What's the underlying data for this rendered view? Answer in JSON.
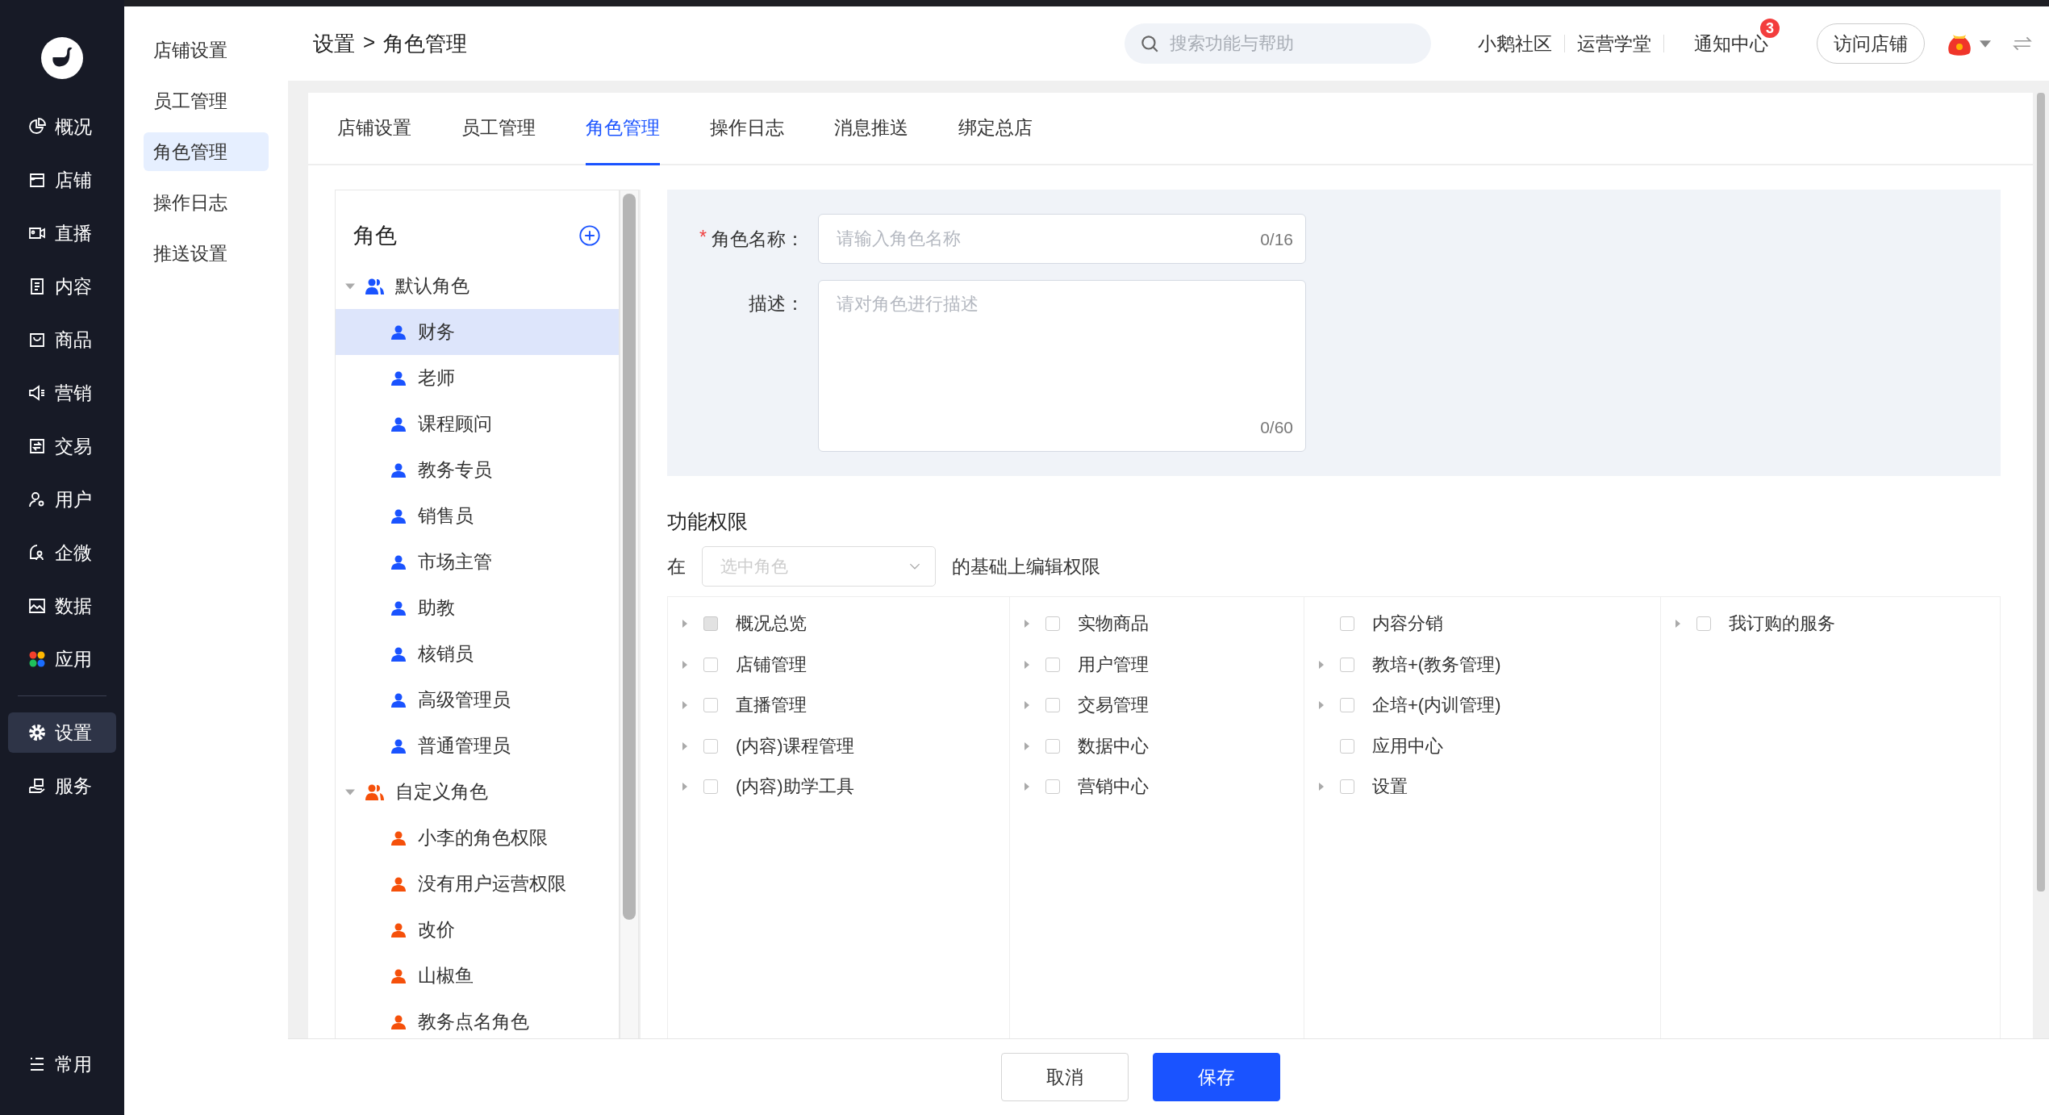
{
  "sidebar": {
    "items": [
      {
        "label": "概况",
        "selected": false
      },
      {
        "label": "店铺",
        "selected": false
      },
      {
        "label": "直播",
        "selected": false
      },
      {
        "label": "内容",
        "selected": false
      },
      {
        "label": "商品",
        "selected": false
      },
      {
        "label": "营销",
        "selected": false
      },
      {
        "label": "交易",
        "selected": false
      },
      {
        "label": "用户",
        "selected": false
      },
      {
        "label": "企微",
        "selected": false
      },
      {
        "label": "数据",
        "selected": false
      },
      {
        "label": "应用",
        "selected": false
      },
      {
        "label": "设置",
        "selected": true
      },
      {
        "label": "服务",
        "selected": false
      }
    ],
    "bottom_item": {
      "label": "常用"
    }
  },
  "subnav": {
    "items": [
      {
        "label": "店铺设置",
        "selected": false
      },
      {
        "label": "员工管理",
        "selected": false
      },
      {
        "label": "角色管理",
        "selected": true
      },
      {
        "label": "操作日志",
        "selected": false
      },
      {
        "label": "推送设置",
        "selected": false
      }
    ]
  },
  "header": {
    "breadcrumb": [
      "设置",
      "角色管理"
    ],
    "separator": ">",
    "search": {
      "placeholder": "搜索功能与帮助"
    },
    "links": [
      {
        "label": "小鹅社区"
      },
      {
        "label": "运营学堂"
      },
      {
        "label": "通知中心",
        "badge": "3"
      }
    ],
    "visit_button": "访问店铺"
  },
  "tabs": [
    {
      "label": "店铺设置",
      "selected": false
    },
    {
      "label": "员工管理",
      "selected": false
    },
    {
      "label": "角色管理",
      "selected": true
    },
    {
      "label": "操作日志",
      "selected": false
    },
    {
      "label": "消息推送",
      "selected": false
    },
    {
      "label": "绑定总店",
      "selected": false
    }
  ],
  "roles": {
    "title": "角色",
    "groups": [
      {
        "label": "默认角色",
        "expanded": true,
        "color": "#1a53ff",
        "children": [
          {
            "label": "财务",
            "selected": true
          },
          {
            "label": "老师",
            "selected": false
          },
          {
            "label": "课程顾问",
            "selected": false
          },
          {
            "label": "教务专员",
            "selected": false
          },
          {
            "label": "销售员",
            "selected": false
          },
          {
            "label": "市场主管",
            "selected": false
          },
          {
            "label": "助教",
            "selected": false
          },
          {
            "label": "核销员",
            "selected": false
          },
          {
            "label": "高级管理员",
            "selected": false
          },
          {
            "label": "普通管理员",
            "selected": false
          }
        ]
      },
      {
        "label": "自定义角色",
        "expanded": true,
        "color": "#f5500a",
        "children": [
          {
            "label": "小李的角色权限",
            "selected": false
          },
          {
            "label": "没有用户运营权限",
            "selected": false
          },
          {
            "label": "改价",
            "selected": false
          },
          {
            "label": "山椒鱼",
            "selected": false
          },
          {
            "label": "教务点名角色",
            "selected": false
          }
        ]
      }
    ]
  },
  "form": {
    "name": {
      "label": "角色名称：",
      "required_mark": "*",
      "placeholder": "请输入角色名称",
      "counter": "0/16"
    },
    "description": {
      "label": "描述：",
      "placeholder": "请对角色进行描述",
      "counter": "0/60"
    }
  },
  "permissions": {
    "title": "功能权限",
    "prefix": "在",
    "select": {
      "placeholder": "选中角色"
    },
    "suffix": "的基础上编辑权限",
    "columns": [
      [
        {
          "label": "概况总览",
          "expandable": true,
          "checked": false,
          "disabled": true
        },
        {
          "label": "店铺管理",
          "expandable": true,
          "checked": false,
          "disabled": false
        },
        {
          "label": "直播管理",
          "expandable": true,
          "checked": false,
          "disabled": false
        },
        {
          "label": "(内容)课程管理",
          "expandable": true,
          "checked": false,
          "disabled": false
        },
        {
          "label": "(内容)助学工具",
          "expandable": true,
          "checked": false,
          "disabled": false
        }
      ],
      [
        {
          "label": "实物商品",
          "expandable": true,
          "checked": false,
          "disabled": false
        },
        {
          "label": "用户管理",
          "expandable": true,
          "checked": false,
          "disabled": false
        },
        {
          "label": "交易管理",
          "expandable": true,
          "checked": false,
          "disabled": false
        },
        {
          "label": "数据中心",
          "expandable": true,
          "checked": false,
          "disabled": false
        },
        {
          "label": "营销中心",
          "expandable": true,
          "checked": false,
          "disabled": false
        }
      ],
      [
        {
          "label": "内容分销",
          "expandable": false,
          "checked": false,
          "disabled": false
        },
        {
          "label": "教培+(教务管理)",
          "expandable": true,
          "checked": false,
          "disabled": false
        },
        {
          "label": "企培+(内训管理)",
          "expandable": true,
          "checked": false,
          "disabled": false
        },
        {
          "label": "应用中心",
          "expandable": false,
          "checked": false,
          "disabled": false
        },
        {
          "label": "设置",
          "expandable": true,
          "checked": false,
          "disabled": false
        }
      ],
      [
        {
          "label": "我订购的服务",
          "expandable": true,
          "checked": false,
          "disabled": false
        }
      ]
    ]
  },
  "footer": {
    "buttons": [
      {
        "label": "取消",
        "kind": "secondary"
      },
      {
        "label": "保存",
        "kind": "primary"
      }
    ]
  }
}
